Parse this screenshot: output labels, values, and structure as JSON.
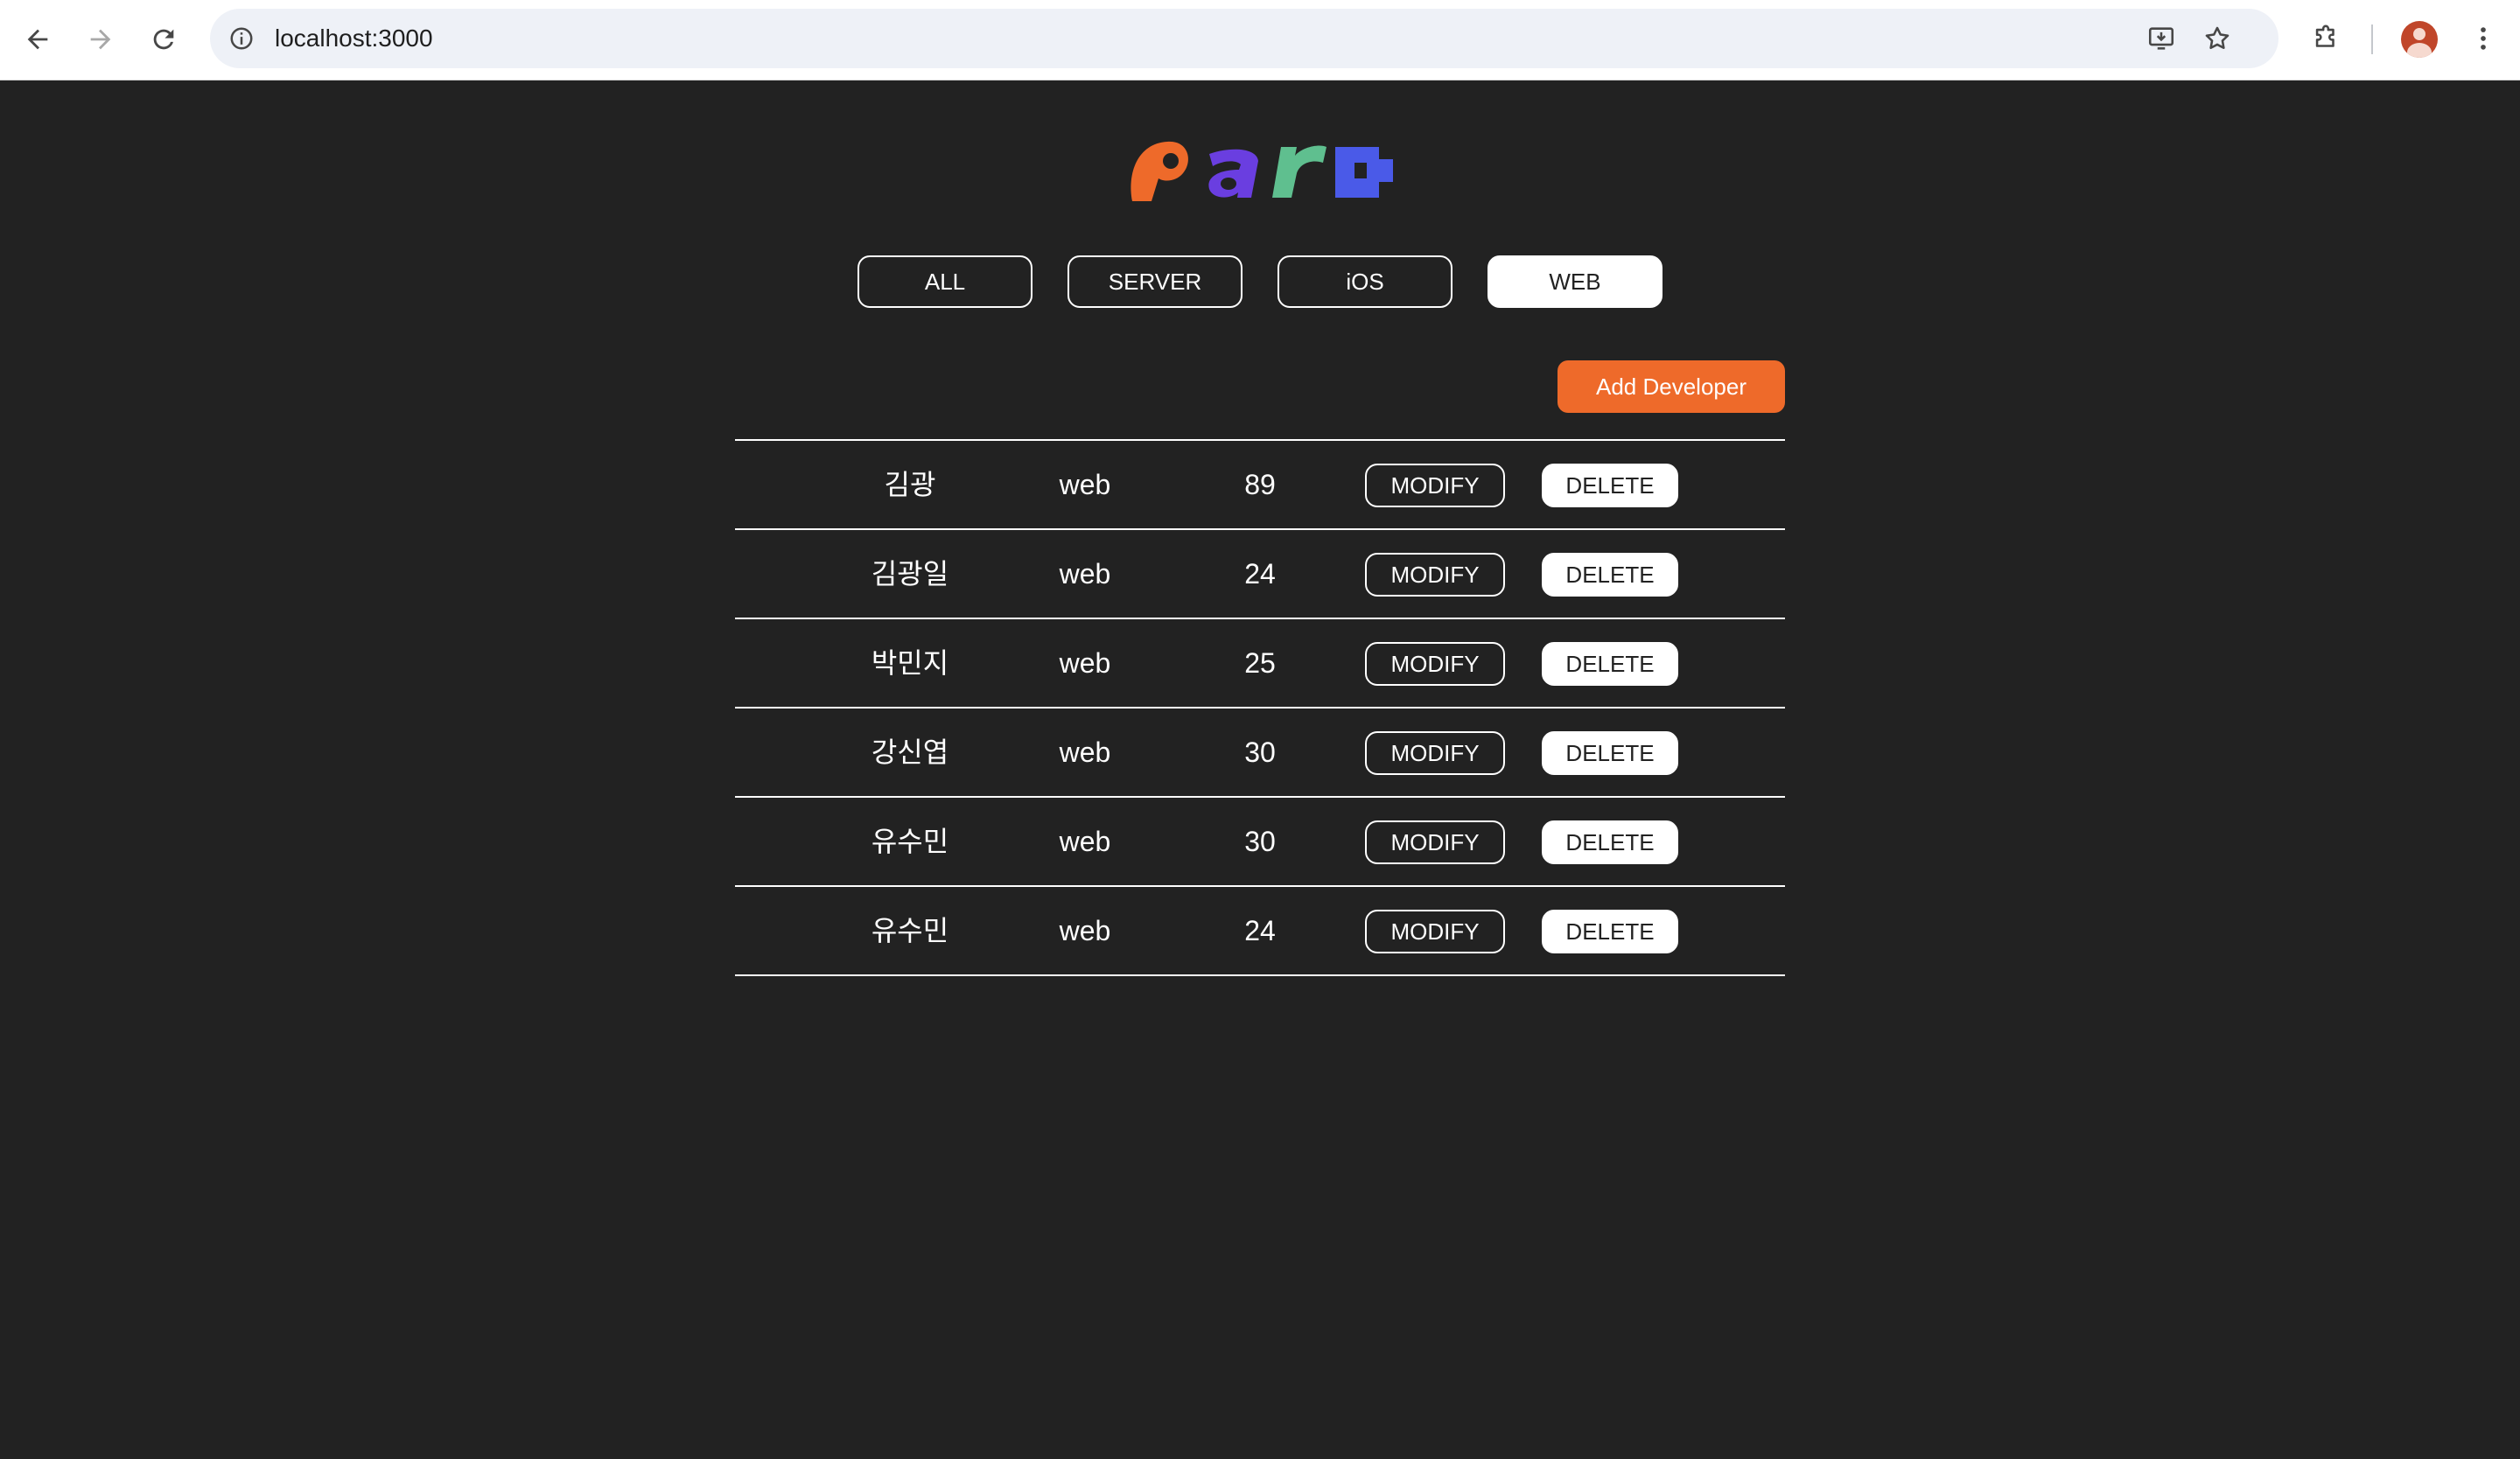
{
  "browser": {
    "url": "localhost:3000"
  },
  "filters": [
    {
      "label": "ALL",
      "active": false
    },
    {
      "label": "SERVER",
      "active": false
    },
    {
      "label": "iOS",
      "active": false
    },
    {
      "label": "WEB",
      "active": true
    }
  ],
  "actions": {
    "add_label": "Add Developer"
  },
  "developers": [
    {
      "name": "김광",
      "part": "web",
      "age": "89",
      "modify_label": "MODIFY",
      "delete_label": "DELETE"
    },
    {
      "name": "김광일",
      "part": "web",
      "age": "24",
      "modify_label": "MODIFY",
      "delete_label": "DELETE"
    },
    {
      "name": "박민지",
      "part": "web",
      "age": "25",
      "modify_label": "MODIFY",
      "delete_label": "DELETE"
    },
    {
      "name": "강신엽",
      "part": "web",
      "age": "30",
      "modify_label": "MODIFY",
      "delete_label": "DELETE"
    },
    {
      "name": "유수민",
      "part": "web",
      "age": "30",
      "modify_label": "MODIFY",
      "delete_label": "DELETE"
    },
    {
      "name": "유수민",
      "part": "web",
      "age": "24",
      "modify_label": "MODIFY",
      "delete_label": "DELETE"
    }
  ],
  "logo": {
    "text": "paro",
    "colors": [
      "#ee6a2a",
      "#6a3ee0",
      "#5fbf8f",
      "#4a5ae8"
    ]
  },
  "colors": {
    "background": "#222222",
    "accent": "#ee6a2a",
    "foreground": "#ffffff"
  },
  "icons": {
    "back": "arrow-left-icon",
    "forward": "arrow-right-icon",
    "reload": "reload-icon",
    "site_info": "info-icon",
    "install": "install-app-icon",
    "bookmark": "star-icon",
    "extensions": "puzzle-icon",
    "profile": "avatar",
    "menu": "kebab-menu-icon"
  }
}
